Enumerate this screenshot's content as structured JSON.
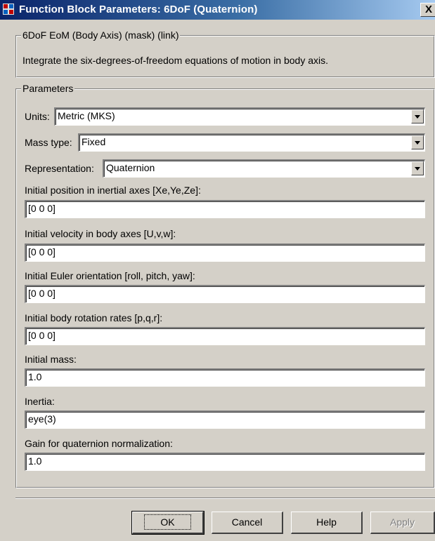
{
  "window": {
    "title": "Function Block Parameters: 6DoF (Quaternion)",
    "close_label": "X"
  },
  "mask": {
    "title": "6DoF EoM (Body Axis) (mask) (link)",
    "description": "Integrate the six-degrees-of-freedom equations of motion in body axis."
  },
  "parameters": {
    "title": "Parameters",
    "units": {
      "label": "Units:",
      "value": "Metric (MKS)"
    },
    "mass_type": {
      "label": "Mass type:",
      "value": "Fixed"
    },
    "representation": {
      "label": "Representation:",
      "value": "Quaternion"
    },
    "fields": [
      {
        "label": "Initial position in inertial axes [Xe,Ye,Ze]:",
        "value": "[0 0 0]"
      },
      {
        "label": "Initial velocity in body axes [U,v,w]:",
        "value": "[0 0 0]"
      },
      {
        "label": "Initial Euler orientation [roll, pitch, yaw]:",
        "value": "[0 0 0]"
      },
      {
        "label": "Initial body rotation rates [p,q,r]:",
        "value": "[0 0 0]"
      },
      {
        "label": "Initial mass:",
        "value": "1.0"
      },
      {
        "label": "Inertia:",
        "value": "eye(3)"
      },
      {
        "label": "Gain for quaternion normalization:",
        "value": "1.0"
      }
    ]
  },
  "buttons": {
    "ok": "OK",
    "cancel": "Cancel",
    "help": "Help",
    "apply": "Apply"
  }
}
